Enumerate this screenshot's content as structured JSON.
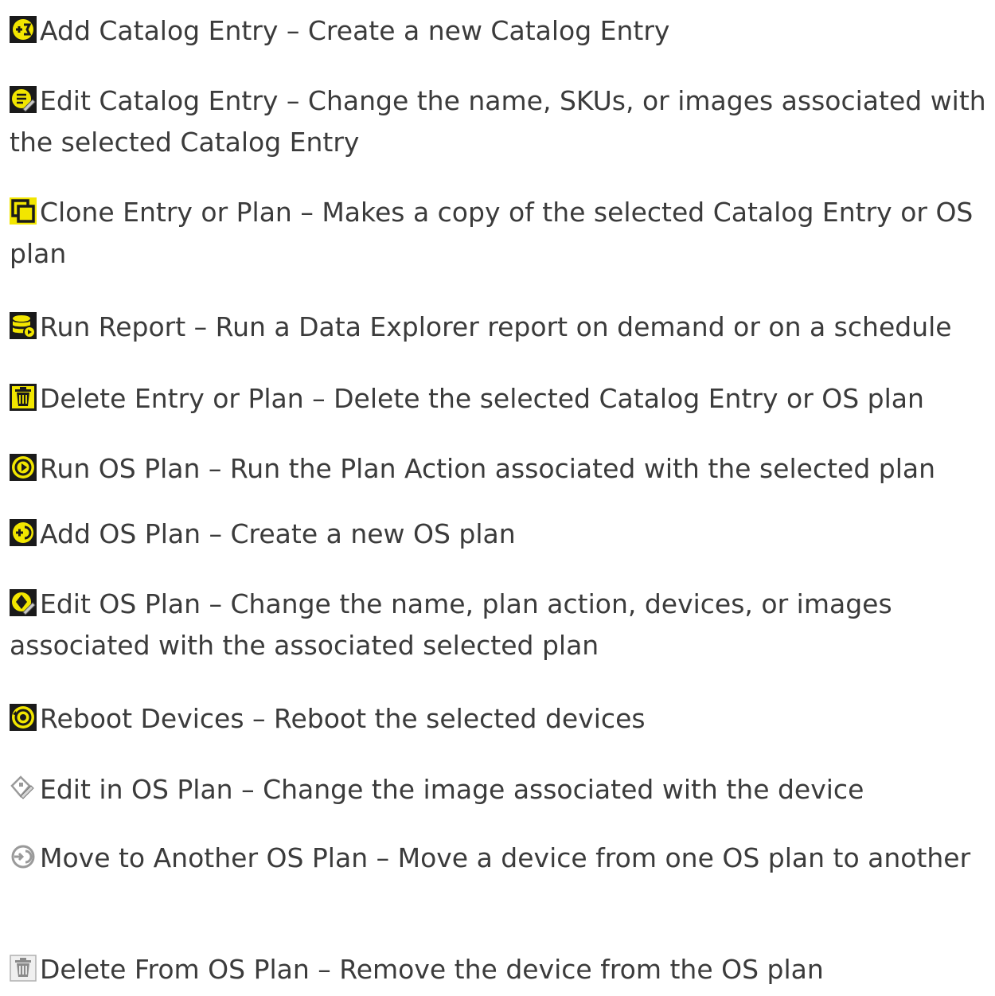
{
  "items": [
    {
      "icon": "add-catalog-entry-icon",
      "text": "Add Catalog Entry – Create a new Catalog Entry"
    },
    {
      "icon": "edit-catalog-entry-icon",
      "text": "Edit Catalog Entry – Change the name, SKUs, or images associated with the selected Catalog Entry"
    },
    {
      "icon": "clone-icon",
      "text": "Clone Entry or Plan – Makes a copy of the selected Catalog Entry or OS plan"
    },
    {
      "icon": "run-report-icon",
      "text": "Run Report – Run a Data Explorer report on demand or on a schedule"
    },
    {
      "icon": "delete-icon",
      "text": "Delete Entry or Plan – Delete the selected Catalog Entry or OS plan"
    },
    {
      "icon": "run-os-plan-icon",
      "text": "Run OS Plan – Run the Plan Action associated with the selected plan"
    },
    {
      "icon": "add-os-plan-icon",
      "text": "Add OS Plan – Create a new OS plan"
    },
    {
      "icon": "edit-os-plan-icon",
      "text": "Edit OS Plan – Change the name, plan action, devices, or images associated with the associated selected plan"
    },
    {
      "icon": "reboot-devices-icon",
      "text": "Reboot Devices – Reboot the selected devices"
    },
    {
      "icon": "edit-in-os-plan-icon",
      "text": "Edit in OS Plan – Change the image associated with the device"
    },
    {
      "icon": "move-os-plan-icon",
      "text": "Move to Another OS Plan – Move a device from one OS plan to another"
    },
    {
      "icon": "delete-from-os-plan-icon",
      "text": "Delete From OS Plan – Remove the device from the OS plan"
    }
  ],
  "colors": {
    "text": "#3b3b3b",
    "icon_yellow": "#f2e600",
    "icon_dark": "#1a1a1a",
    "icon_gray": "#9a9a9a"
  }
}
